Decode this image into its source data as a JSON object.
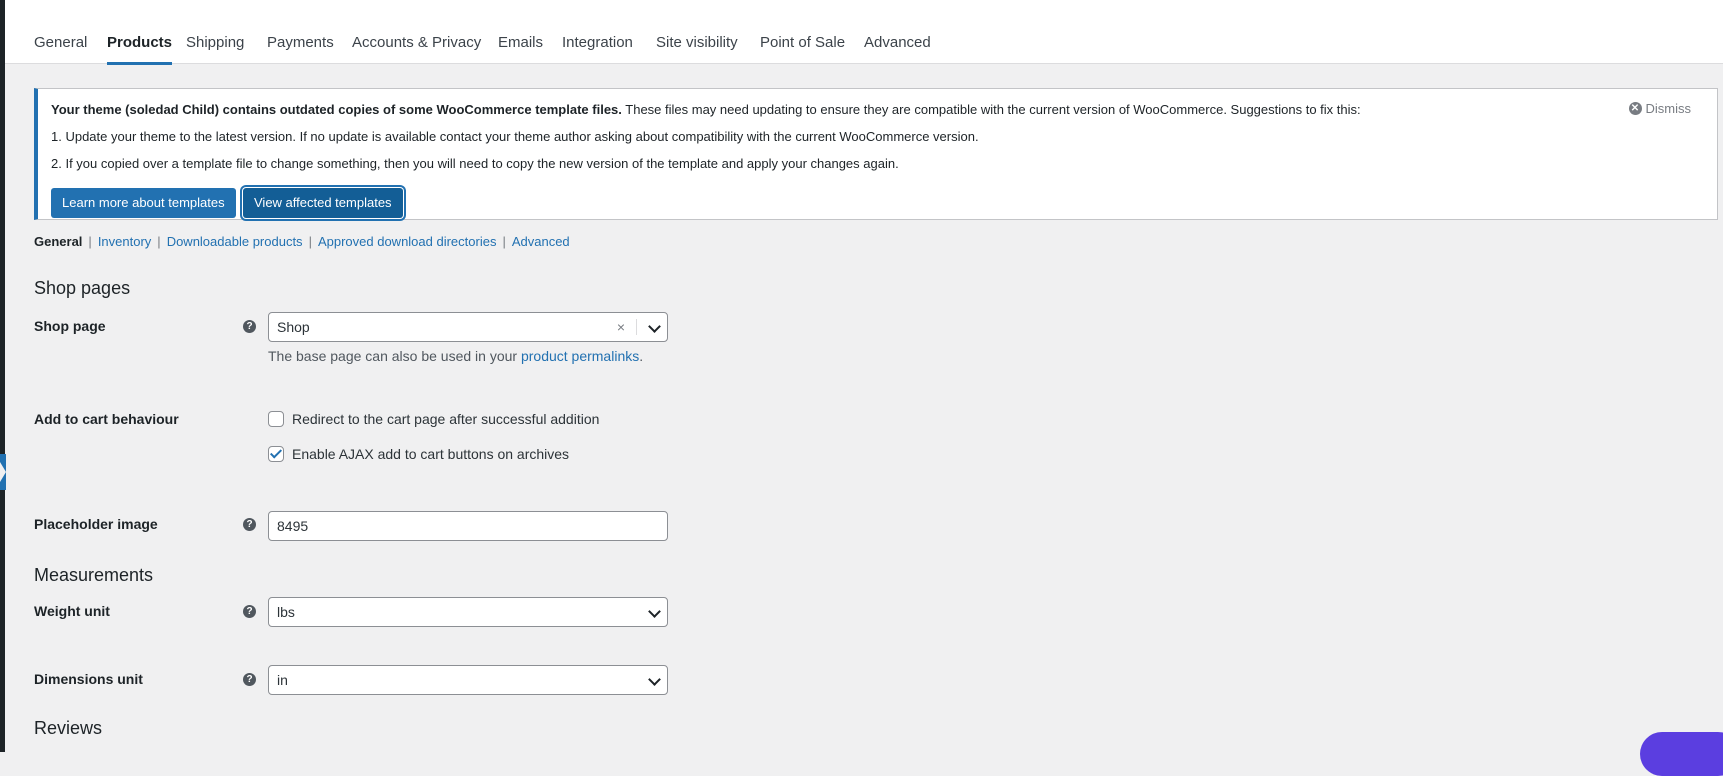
{
  "tabs": [
    "General",
    "Products",
    "Shipping",
    "Payments",
    "Accounts & Privacy",
    "Emails",
    "Integration",
    "Site visibility",
    "Point of Sale",
    "Advanced"
  ],
  "active_tab": "Products",
  "notice": {
    "bold": "Your theme (soledad Child) contains outdated copies of some WooCommerce template files.",
    "text": " These files may need updating to ensure they are compatible with the current version of WooCommerce. Suggestions to fix this:",
    "items": [
      "1. Update your theme to the latest version. If no update is available contact your theme author asking about compatibility with the current WooCommerce version.",
      "2. If you copied over a template file to change something, then you will need to copy the new version of the template and apply your changes again."
    ],
    "dismiss": "Dismiss",
    "btn_learn": "Learn more about templates",
    "btn_view": "View affected templates"
  },
  "subnav": {
    "current": "General",
    "links": [
      "Inventory",
      "Downloadable products",
      "Approved download directories",
      "Advanced"
    ]
  },
  "shop_pages": {
    "heading": "Shop pages",
    "shop_page_label": "Shop page",
    "shop_page_value": "Shop",
    "desc_prefix": "The base page can also be used in your ",
    "desc_link": "product permalinks",
    "desc_suffix": ".",
    "cart_label": "Add to cart behaviour",
    "cb_redirect": "Redirect to the cart page after successful addition",
    "cb_ajax": "Enable AJAX add to cart buttons on archives",
    "cb_redirect_checked": false,
    "cb_ajax_checked": true,
    "placeholder_label": "Placeholder image",
    "placeholder_value": "8495"
  },
  "measurements": {
    "heading": "Measurements",
    "weight_label": "Weight unit",
    "weight_value": "lbs",
    "dimensions_label": "Dimensions unit",
    "dimensions_value": "in"
  },
  "reviews": {
    "heading": "Reviews"
  }
}
